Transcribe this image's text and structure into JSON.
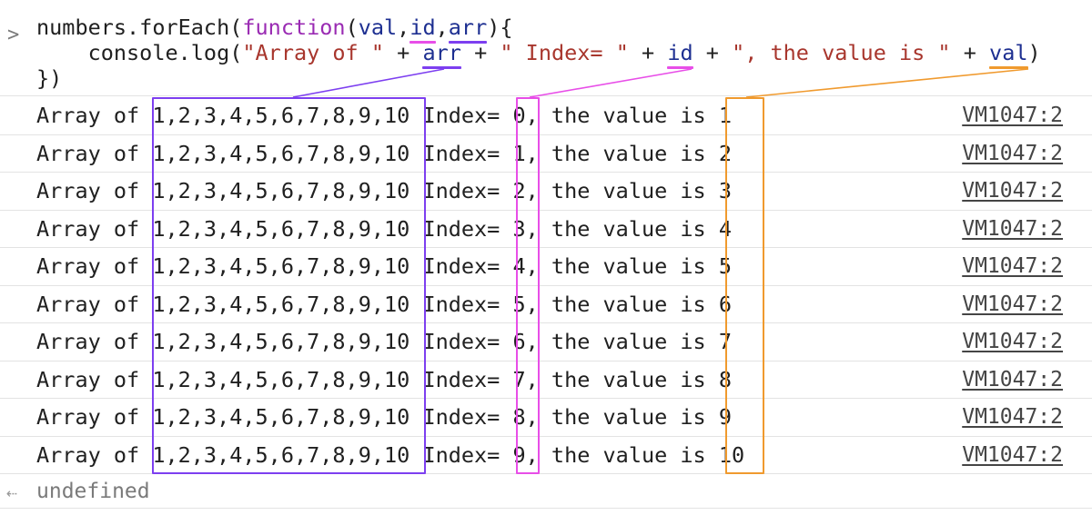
{
  "input": {
    "prompt_icon": "chevron-right-icon",
    "prompt_glyph": ">",
    "line1": {
      "p1": "numbers.forEach(",
      "kw": "function",
      "p2": "(",
      "val": "val",
      "c1": ",",
      "id": "id",
      "c2": ",",
      "arr": "arr",
      "p3": "){"
    },
    "line2": {
      "p1": "    console.log(",
      "s1": "\"Array of \"",
      "op1": " + ",
      "arr": "arr",
      "op2": " + ",
      "s2": "\" Index= \"",
      "op3": " + ",
      "id": "id",
      "op4": " + ",
      "s3": "\", the value is \"",
      "op5": " + ",
      "val": "val",
      "p2": ")"
    },
    "line3": "})"
  },
  "log_rows": [
    {
      "text": "Array of 1,2,3,4,5,6,7,8,9,10 Index= 0, the value is 1",
      "source": "VM1047:2"
    },
    {
      "text": "Array of 1,2,3,4,5,6,7,8,9,10 Index= 1, the value is 2",
      "source": "VM1047:2"
    },
    {
      "text": "Array of 1,2,3,4,5,6,7,8,9,10 Index= 2, the value is 3",
      "source": "VM1047:2"
    },
    {
      "text": "Array of 1,2,3,4,5,6,7,8,9,10 Index= 3, the value is 4",
      "source": "VM1047:2"
    },
    {
      "text": "Array of 1,2,3,4,5,6,7,8,9,10 Index= 4, the value is 5",
      "source": "VM1047:2"
    },
    {
      "text": "Array of 1,2,3,4,5,6,7,8,9,10 Index= 5, the value is 6",
      "source": "VM1047:2"
    },
    {
      "text": "Array of 1,2,3,4,5,6,7,8,9,10 Index= 6, the value is 7",
      "source": "VM1047:2"
    },
    {
      "text": "Array of 1,2,3,4,5,6,7,8,9,10 Index= 7, the value is 8",
      "source": "VM1047:2"
    },
    {
      "text": "Array of 1,2,3,4,5,6,7,8,9,10 Index= 8, the value is 9",
      "source": "VM1047:2"
    },
    {
      "text": "Array of 1,2,3,4,5,6,7,8,9,10 Index= 9, the value is 10",
      "source": "VM1047:2"
    }
  ],
  "result": {
    "icon": "return-arrow-icon",
    "glyph": "⇠",
    "text": "undefined"
  },
  "colors": {
    "arr_highlight": "#7d3ff0",
    "id_highlight": "#e84ee8",
    "val_highlight": "#f09a2e",
    "keyword": "#9a2bb3",
    "variable": "#1d2f91",
    "string": "#a8362d"
  }
}
